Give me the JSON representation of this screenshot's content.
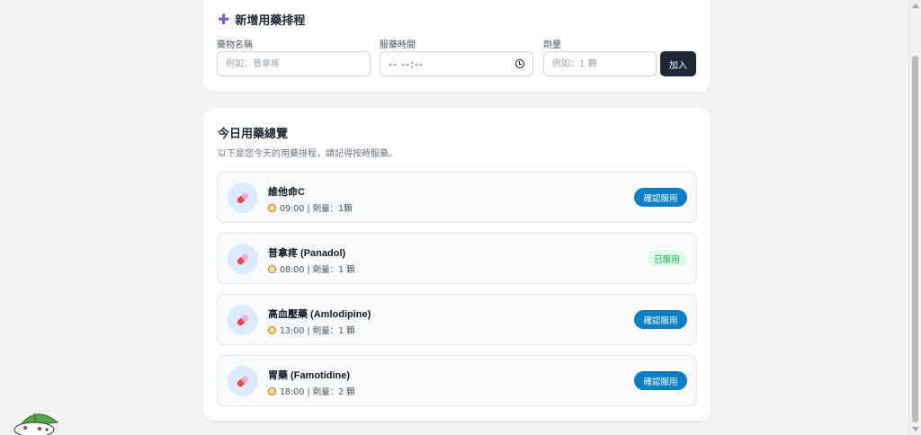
{
  "add_form": {
    "title": "新增用藥排程",
    "name_label": "藥物名稱",
    "name_placeholder": "例如：普拿疼",
    "time_label": "服藥時間",
    "time_value": "-- --:--",
    "dose_label": "劑量",
    "dose_placeholder": "例如：1 顆",
    "add_button": "加入"
  },
  "overview": {
    "title": "今日用藥總覽",
    "subtitle": "以下是您今天的用藥排程，請記得按時服藥。",
    "items": [
      {
        "name": "維他命C",
        "meta": "09:00 | 劑量：1顆",
        "action": "確認服用",
        "taken": false
      },
      {
        "name": "普拿疼 (Panadol)",
        "meta": "08:00 | 劑量：1 顆",
        "action": "已服用",
        "taken": true
      },
      {
        "name": "高血壓藥 (Amlodipine)",
        "meta": "13:00 | 劑量：1 顆",
        "action": "確認服用",
        "taken": false
      },
      {
        "name": "胃藥 (Famotidine)",
        "meta": "18:00 | 劑量：2 顆",
        "action": "確認服用",
        "taken": false
      }
    ]
  },
  "colors": {
    "confirm_button": "#0b7fc4",
    "taken_badge_bg": "#dcfce7",
    "taken_badge_text": "#16a34a",
    "add_button": "#1e2838",
    "accent_plus": "#7c5cbf"
  },
  "icons": {
    "add": "plus-icon",
    "time": "clock-icon",
    "medicine": "pill-icon",
    "schedule": "alarm-clock-icon"
  }
}
